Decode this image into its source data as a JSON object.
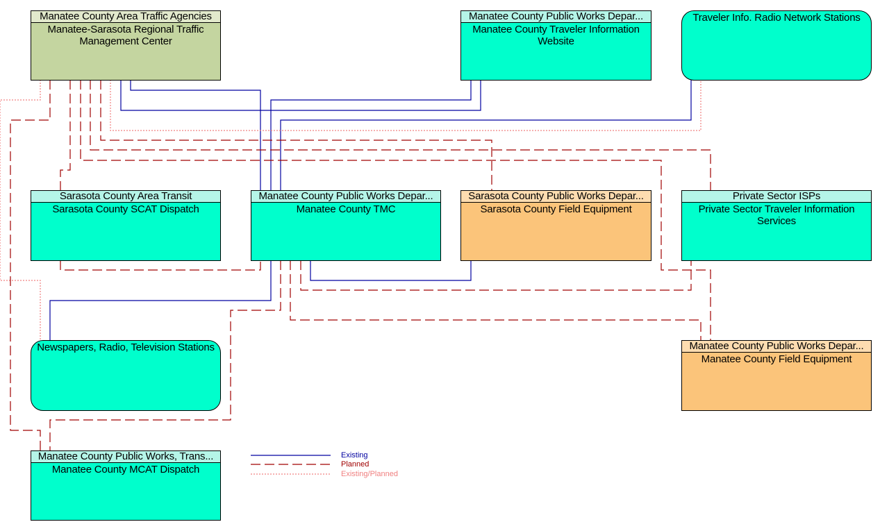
{
  "diagram": {
    "nodes": [
      {
        "id": "mstmc",
        "header": "Manatee County Area Traffic Agencies",
        "name": "Manatee-Sarasota Regional Traffic Management Center",
        "style": "olive"
      },
      {
        "id": "web",
        "header": "Manatee County Public Works Depar...",
        "name": "Manatee County Traveler Information Website",
        "style": "teal"
      },
      {
        "id": "radio",
        "header": "",
        "name": "Traveler Info. Radio Network Stations",
        "style": "rounded"
      },
      {
        "id": "scat",
        "header": "Sarasota County Area Transit",
        "name": "Sarasota County SCAT Dispatch",
        "style": "teal"
      },
      {
        "id": "tmc",
        "header": "Manatee County Public Works Depar...",
        "name": "Manatee County TMC",
        "style": "teal"
      },
      {
        "id": "sfe",
        "header": "Sarasota County Public Works Depar...",
        "name": "Sarasota County Field Equipment",
        "style": "orange"
      },
      {
        "id": "isp",
        "header": "Private Sector ISPs",
        "name": "Private Sector Traveler Information Services",
        "style": "teal"
      },
      {
        "id": "media",
        "header": "",
        "name": "Newspapers, Radio, Television Stations",
        "style": "rounded"
      },
      {
        "id": "mfe",
        "header": "Manatee County Public Works Depar...",
        "name": "Manatee County Field Equipment",
        "style": "orange"
      },
      {
        "id": "mcat",
        "header": "Manatee County Public Works, Trans...",
        "name": "Manatee County MCAT Dispatch",
        "style": "teal"
      }
    ],
    "legend": [
      {
        "label": "Existing",
        "status": "existing",
        "color": "#0000a0"
      },
      {
        "label": "Planned",
        "status": "planned",
        "color": "#a00000"
      },
      {
        "label": "Existing/Planned",
        "status": "existing-planned",
        "color": "#f08080"
      }
    ],
    "colors": {
      "existing": "#0000a0",
      "planned": "#a00000",
      "existing_planned": "#f08080"
    }
  }
}
